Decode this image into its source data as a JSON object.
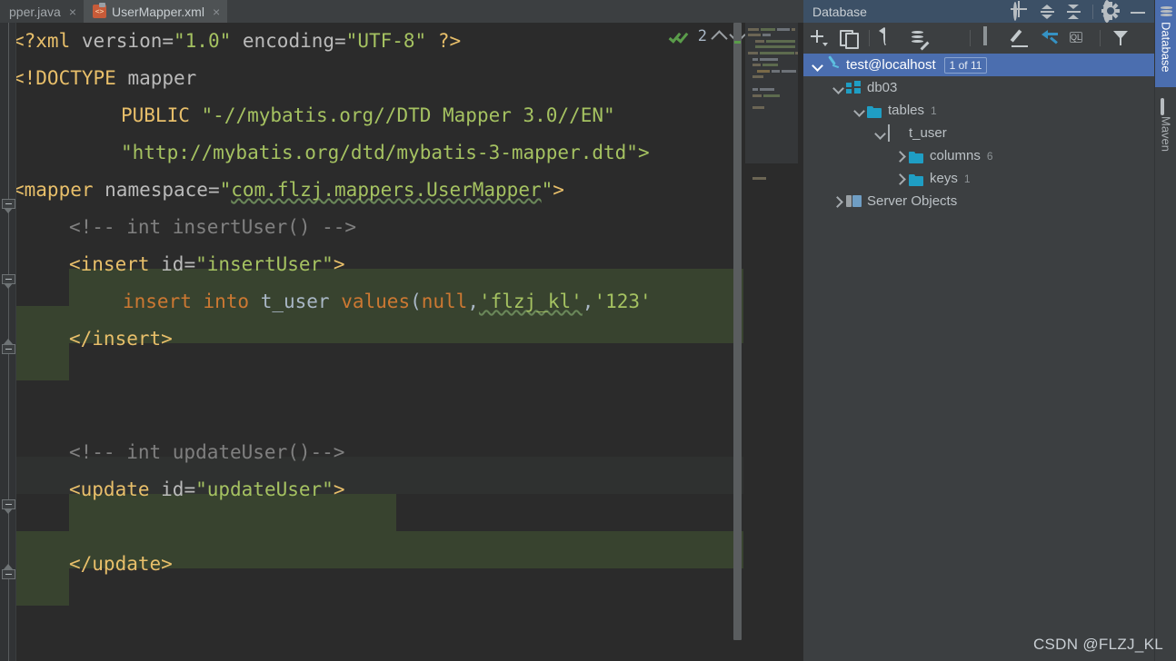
{
  "editor": {
    "tabs": [
      {
        "label": "pper.java",
        "icon": "java-file-icon",
        "active": false,
        "close": "×"
      },
      {
        "label": "UserMapper.xml",
        "icon": "xml-file-icon",
        "active": true,
        "close": "×"
      }
    ],
    "inspection": {
      "count": "2",
      "status_icon": "double-check-icon",
      "prev_icon": "chevron-up-icon",
      "next_icon": "chevron-down-icon"
    },
    "code": {
      "line1": {
        "proc_open": "<?xml ",
        "attr1": "version=",
        "val1": "\"1.0\"",
        "attr2": " encoding=",
        "val2": "\"UTF-8\"",
        "proc_close": " ?>"
      },
      "line2": {
        "doctype": "<!DOCTYPE ",
        "name": "mapper"
      },
      "line3": {
        "public": "PUBLIC ",
        "id": "\"-//mybatis.org//DTD Mapper 3.0//EN\""
      },
      "line4": {
        "sysid": "\"http://mybatis.org/dtd/mybatis-3-mapper.dtd\">"
      },
      "line5": {
        "tag_open": "<mapper ",
        "attr": "namespace=",
        "quote_open": "\"",
        "value": "com.flzj.mappers.UserMapper",
        "quote_close": "\"",
        "tag_close": ">"
      },
      "line6": {
        "comment": "<!-- int insertUser() -->"
      },
      "line7": {
        "tag_open": "<insert ",
        "attr": "id=",
        "value": "\"insertUser\"",
        "tag_close": ">"
      },
      "line8": {
        "kw_insert": "insert into ",
        "table": "t_user ",
        "kw_values": "values",
        "paren_open": "(",
        "kw_null": "null",
        "comma1": ",",
        "str1": "'flzj_kl'",
        "comma2": ",",
        "str2": "'123'"
      },
      "line9": {
        "tag": "</insert>"
      },
      "line10": {
        "comment": "<!-- int updateUser()-->"
      },
      "line11": {
        "tag_open": "<update ",
        "attr": "id=",
        "value": "\"updateUser\"",
        "tag_close": ">"
      },
      "line12": {
        "tag": "</update>"
      }
    },
    "gutter": {
      "lightbulb_icon": "lightbulb-icon",
      "fold_icon": "fold-collapse-icon"
    }
  },
  "database_panel": {
    "title": "Database",
    "header_icons": [
      {
        "name": "locate-icon"
      },
      {
        "name": "expand-all-icon"
      },
      {
        "name": "collapse-all-icon"
      },
      {
        "name": "settings-gear-icon"
      },
      {
        "name": "minimize-icon"
      }
    ],
    "toolbar_icons": [
      {
        "name": "add-icon"
      },
      {
        "name": "duplicate-icon"
      },
      {
        "name": "refresh-icon"
      },
      {
        "name": "sync-database-icon"
      },
      {
        "name": "stop-icon"
      },
      {
        "name": "data-grid-icon"
      },
      {
        "name": "edit-pencil-icon"
      },
      {
        "name": "jump-to-source-icon"
      },
      {
        "name": "query-console-icon"
      },
      {
        "name": "filter-icon"
      }
    ],
    "tree": [
      {
        "label": "test@localhost",
        "icon": "mysql-icon",
        "indent": 0,
        "arrow": "expanded",
        "selected": true,
        "chip": "1 of 11"
      },
      {
        "label": "db03",
        "icon": "schema-icon",
        "indent": 1,
        "arrow": "expanded",
        "selected": false
      },
      {
        "label": "tables",
        "icon": "folder-icon",
        "indent": 2,
        "arrow": "expanded",
        "selected": false,
        "count": "1"
      },
      {
        "label": "t_user",
        "icon": "table-icon",
        "indent": 3,
        "arrow": "expanded",
        "selected": false
      },
      {
        "label": "columns",
        "icon": "folder-icon",
        "indent": 4,
        "arrow": "collapsed",
        "selected": false,
        "count": "6"
      },
      {
        "label": "keys",
        "icon": "folder-icon",
        "indent": 4,
        "arrow": "collapsed",
        "selected": false,
        "count": "1"
      },
      {
        "label": "Server Objects",
        "icon": "server-objects-icon",
        "indent": 1,
        "arrow": "collapsed",
        "selected": false
      }
    ]
  },
  "right_strip": {
    "tabs": [
      {
        "label": "Database",
        "icon": "database-icon",
        "active": true
      },
      {
        "label": "Maven",
        "icon": "maven-icon",
        "active": false
      }
    ]
  },
  "watermark": {
    "text": "CSDN @FLZJ_KL"
  },
  "colors": {
    "editor_bg": "#2b2b2b",
    "panel_bg": "#3c3f41",
    "header_bg": "#3c5066",
    "selection_blue": "#4b6eaf",
    "tag": "#e8bf6a",
    "value": "#a5c261",
    "comment": "#808080",
    "sql_keyword": "#cc7832",
    "injected_sql_bg": "#38432f",
    "stop_red": "#cf5b56",
    "accent_blue": "#3592c4"
  }
}
